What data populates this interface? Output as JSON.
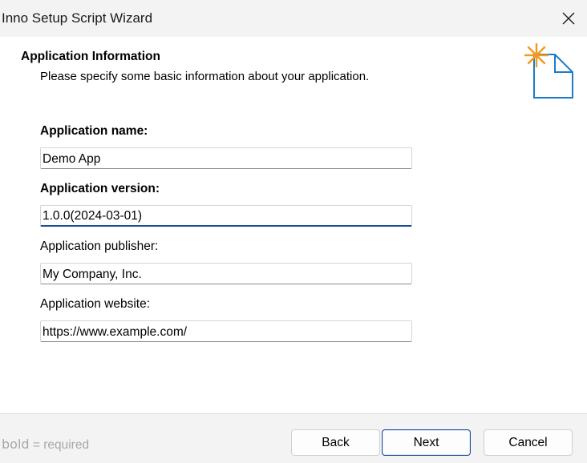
{
  "window": {
    "title": "Inno Setup Script Wizard"
  },
  "header": {
    "title": "Application Information",
    "subtitle": "Please specify some basic information about your application."
  },
  "form": {
    "app_name": {
      "label": "Application name:",
      "value": "Demo App",
      "required": true
    },
    "app_version": {
      "label": "Application version:",
      "value": "1.0.0(2024-03-01)",
      "required": true,
      "focused": true
    },
    "app_publisher": {
      "label": "Application publisher:",
      "value": "My Company, Inc.",
      "required": false
    },
    "app_website": {
      "label": "Application website:",
      "value": "https://www.example.com/",
      "required": false
    }
  },
  "footer": {
    "hint_bold": "bold",
    "hint_rest": " = required",
    "back_label": "Back",
    "next_label": "Next",
    "cancel_label": "Cancel"
  },
  "colors": {
    "accent": "#1e4d9c",
    "icon_star": "#f39a1e",
    "icon_page": "#1d7cc9"
  },
  "icons": {
    "close": "close-icon",
    "wizard": "new-document-icon"
  }
}
